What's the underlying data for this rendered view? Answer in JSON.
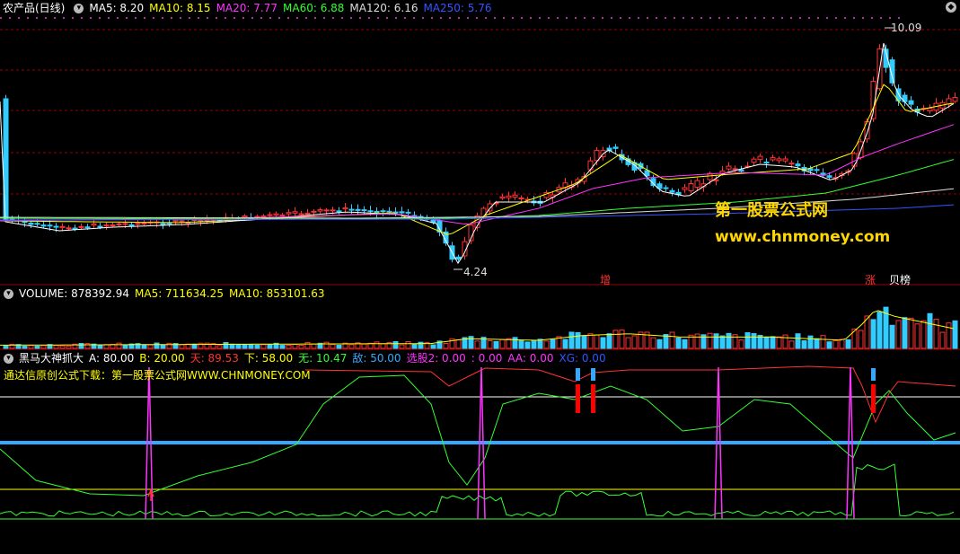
{
  "main": {
    "title": "农产品(日线)",
    "ma": [
      {
        "label": "MA5: 8.20",
        "color": "#ffffff"
      },
      {
        "label": "MA10: 8.15",
        "color": "#ffff00"
      },
      {
        "label": "MA20: 7.77",
        "color": "#ff33ff"
      },
      {
        "label": "MA60: 6.88",
        "color": "#33ff33"
      },
      {
        "label": "MA120: 6.16",
        "color": "#dddddd"
      },
      {
        "label": "MA250: 5.76",
        "color": "#3355ff"
      }
    ],
    "high_label": "10.09",
    "low_label": "4.24",
    "marker_zeng": "增",
    "marker_zhang": "涨",
    "marker_bang": "贝榜",
    "watermark_cn": "第一股票公式网",
    "watermark_url": "www.chnmoney.com"
  },
  "volume": {
    "items": [
      {
        "label": "VOLUME: 878392.94",
        "color": "#ffffff"
      },
      {
        "label": "MA5: 711634.25",
        "color": "#ffff00"
      },
      {
        "label": "MA10: 853101.63",
        "color": "#ffff00"
      }
    ]
  },
  "indicator": {
    "title": "黑马大神抓大",
    "items": [
      {
        "label": "A: 80.00",
        "color": "#ffffff"
      },
      {
        "label": "B: 20.00",
        "color": "#ffff00"
      },
      {
        "label": "天: 89.53",
        "color": "#ff3333"
      },
      {
        "label": "下: 58.00",
        "color": "#ffff00"
      },
      {
        "label": "无: 10.47",
        "color": "#33ff33"
      },
      {
        "label": "敌: 50.00",
        "color": "#33aaff"
      },
      {
        "label": "选股2: 0.00",
        "color": "#ff33ff"
      },
      {
        "label": ": 0.00",
        "color": "#ff33ff"
      },
      {
        "label": "AA: 0.00",
        "color": "#ff33ff"
      },
      {
        "label": "XG: 0.00",
        "color": "#3355ff"
      }
    ],
    "subtitle": "通达信原创公式下载：第一股票公式网WWW.CHNMONEY.COM"
  }
}
